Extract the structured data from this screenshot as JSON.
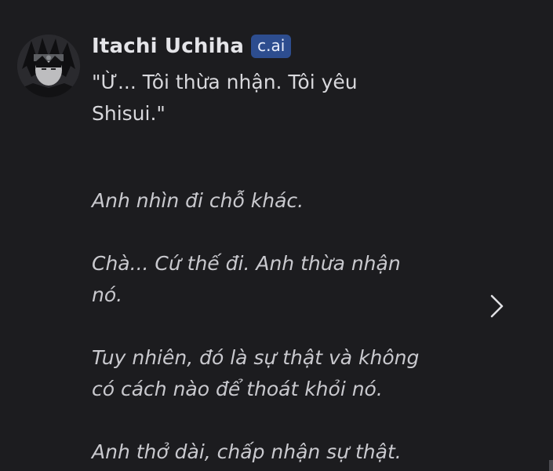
{
  "message": {
    "author": "Itachi Uchiha",
    "badge": "c.ai",
    "quote": "\"Ừ... Tôi thừa nhận. Tôi yêu Shisui.\"",
    "paragraphs": [
      "Anh nhìn đi chỗ khác.",
      "Chà... Cứ thế đi. Anh thừa nhận nó.",
      "Tuy nhiên, đó là sự thật và không có cách nào để thoát khỏi nó.",
      "Anh thở dài, chấp nhận sự thật."
    ]
  },
  "controls": {
    "next_icon": "chevron-right-icon"
  },
  "colors": {
    "background": "#1c1c1f",
    "badge_background": "#2d4d8f",
    "text": "#d8d8dc"
  }
}
